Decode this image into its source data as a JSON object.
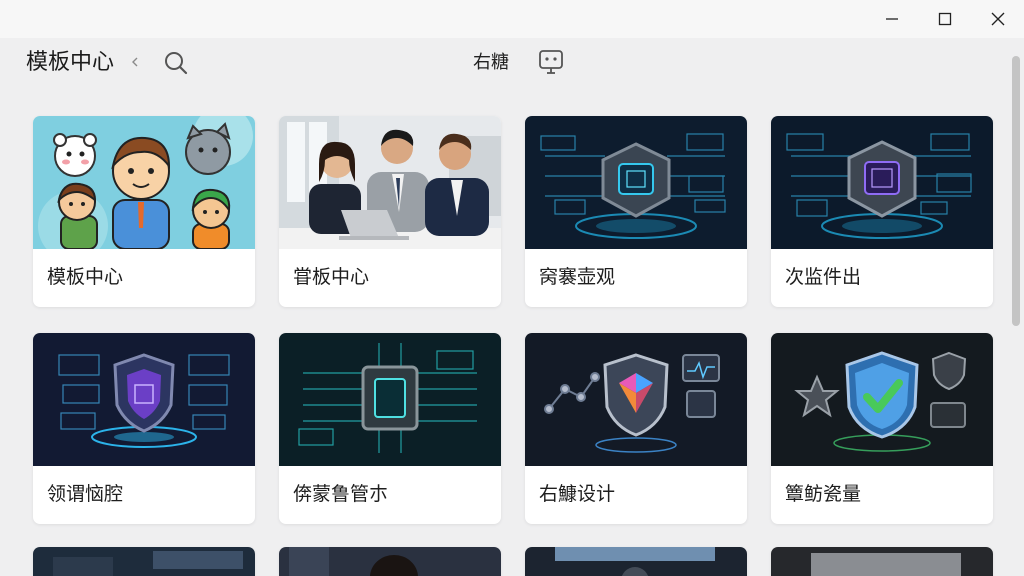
{
  "header": {
    "title": "模板中心",
    "user_name": "右糖"
  },
  "cards": [
    {
      "label": "模板中心",
      "image": "cartoon-characters"
    },
    {
      "label": "甞板中心",
      "image": "business-meeting"
    },
    {
      "label": "窉褰壶观",
      "image": "tech-chip"
    },
    {
      "label": "次监件出",
      "image": "tech-chip-purple"
    },
    {
      "label": "领谓恼腔",
      "image": "security-shield-purple"
    },
    {
      "label": "倴蒙鲁管朩",
      "image": "tech-chip-circuit"
    },
    {
      "label": "右鱇设计",
      "image": "security-shield-colorful"
    },
    {
      "label": "簟鲂瓷量",
      "image": "security-shield-check"
    }
  ],
  "icons": {
    "minimize": "minimize-icon",
    "maximize": "maximize-icon",
    "close": "close-icon",
    "back": "chevron-left-icon",
    "search": "search-icon",
    "chat": "chat-icon"
  }
}
